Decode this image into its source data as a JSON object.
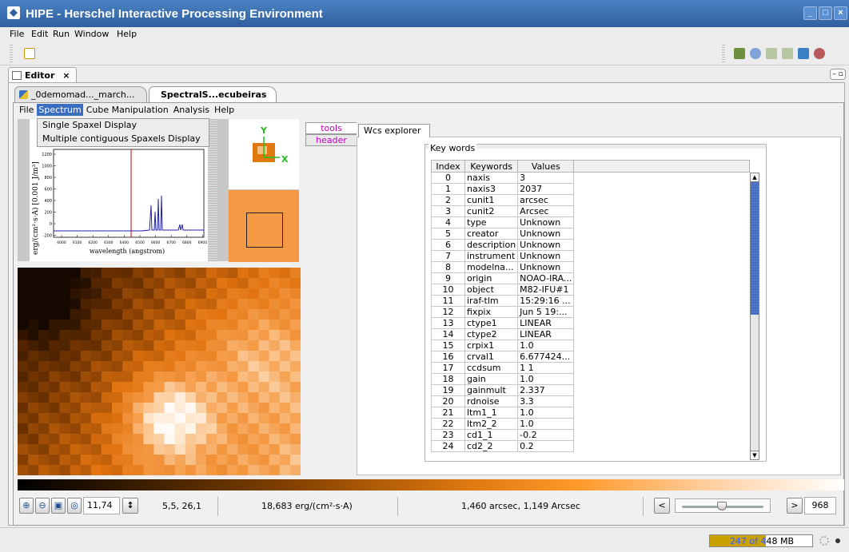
{
  "window": {
    "title": "HIPE - Herschel Interactive Processing Environment"
  },
  "menubar": [
    "File",
    "Edit",
    "Run",
    "Window",
    "Help"
  ],
  "perspective": {
    "editor_tab": "Editor"
  },
  "doc_tabs": [
    {
      "label": "_0demomad..._march...",
      "active": false
    },
    {
      "label": "SpectralS...ecubeiras",
      "active": true
    }
  ],
  "app_menu": {
    "items": [
      "File",
      "Spectrum",
      "Cube Manipulation",
      "Analysis",
      "Help"
    ],
    "open": "Spectrum",
    "dropdown": [
      "Single Spaxel Display",
      "Multiple contiguous Spaxels Display"
    ]
  },
  "spectrum_plot": {
    "ylabel": "erg/(cm²·s·A) [0.001 J/m³]",
    "xlabel": "wavelength (angstrom)",
    "yticks": [
      "1200",
      "1000",
      "800",
      "600",
      "400",
      "200",
      "0",
      "-200"
    ],
    "xticks": [
      "6000",
      "6100",
      "6200",
      "6300",
      "6400",
      "6500",
      "6600",
      "6700",
      "6800",
      "6900"
    ]
  },
  "wcs_compass": {
    "y_label": "Y",
    "x_label": "X"
  },
  "side_tabs": [
    "tools",
    "header"
  ],
  "wcs_tab": "Wcs explorer",
  "keywords": {
    "group_title": "Key words",
    "columns": [
      "Index",
      "Keywords",
      "Values"
    ],
    "rows": [
      [
        "0",
        "naxis",
        "3"
      ],
      [
        "1",
        "naxis3",
        "2037"
      ],
      [
        "2",
        "cunit1",
        "arcsec"
      ],
      [
        "3",
        "cunit2",
        "Arcsec"
      ],
      [
        "4",
        "type",
        "Unknown"
      ],
      [
        "5",
        "creator",
        "Unknown"
      ],
      [
        "6",
        "description",
        "Unknown"
      ],
      [
        "7",
        "instrument",
        "Unknown"
      ],
      [
        "8",
        "modelna...",
        "Unknown"
      ],
      [
        "9",
        "origin",
        "NOAO-IRA..."
      ],
      [
        "10",
        "object",
        "M82-IFU#1"
      ],
      [
        "11",
        "iraf-tlm",
        "15:29:16 ..."
      ],
      [
        "12",
        "fixpix",
        "Jun  5 19:..."
      ],
      [
        "13",
        "ctype1",
        "LINEAR"
      ],
      [
        "14",
        "ctype2",
        "LINEAR"
      ],
      [
        "15",
        "crpix1",
        "1.0"
      ],
      [
        "16",
        "crval1",
        "6.677424..."
      ],
      [
        "17",
        "ccdsum",
        "1 1"
      ],
      [
        "18",
        "gain",
        "1.0"
      ],
      [
        "19",
        "gainmult",
        "2.337"
      ],
      [
        "20",
        "rdnoise",
        "3.3"
      ],
      [
        "21",
        "ltm1_1",
        "1.0"
      ],
      [
        "22",
        "ltm2_2",
        "1.0"
      ],
      [
        "23",
        "cd1_1",
        "-0.2"
      ],
      [
        "24",
        "cd2_2",
        "0.2"
      ]
    ]
  },
  "status": {
    "zoom_value": "11,74",
    "pixel": "5,5, 26,1",
    "flux": "18,683 erg/(cm²·s·A)",
    "coords": "1,460 arcsec, 1,149 Arcsec",
    "slice_prev": "<",
    "slice_next": ">",
    "slice_value": "968",
    "slice_fraction": 0.48
  },
  "memory": {
    "text": "247 of 448 MB",
    "used_fraction": 0.55
  },
  "colors": {
    "title_bar": "#2f5f9e",
    "menu_active": "#3a6ec0",
    "image_orange": "#f49a45",
    "memory_fill": "#c8a000"
  }
}
